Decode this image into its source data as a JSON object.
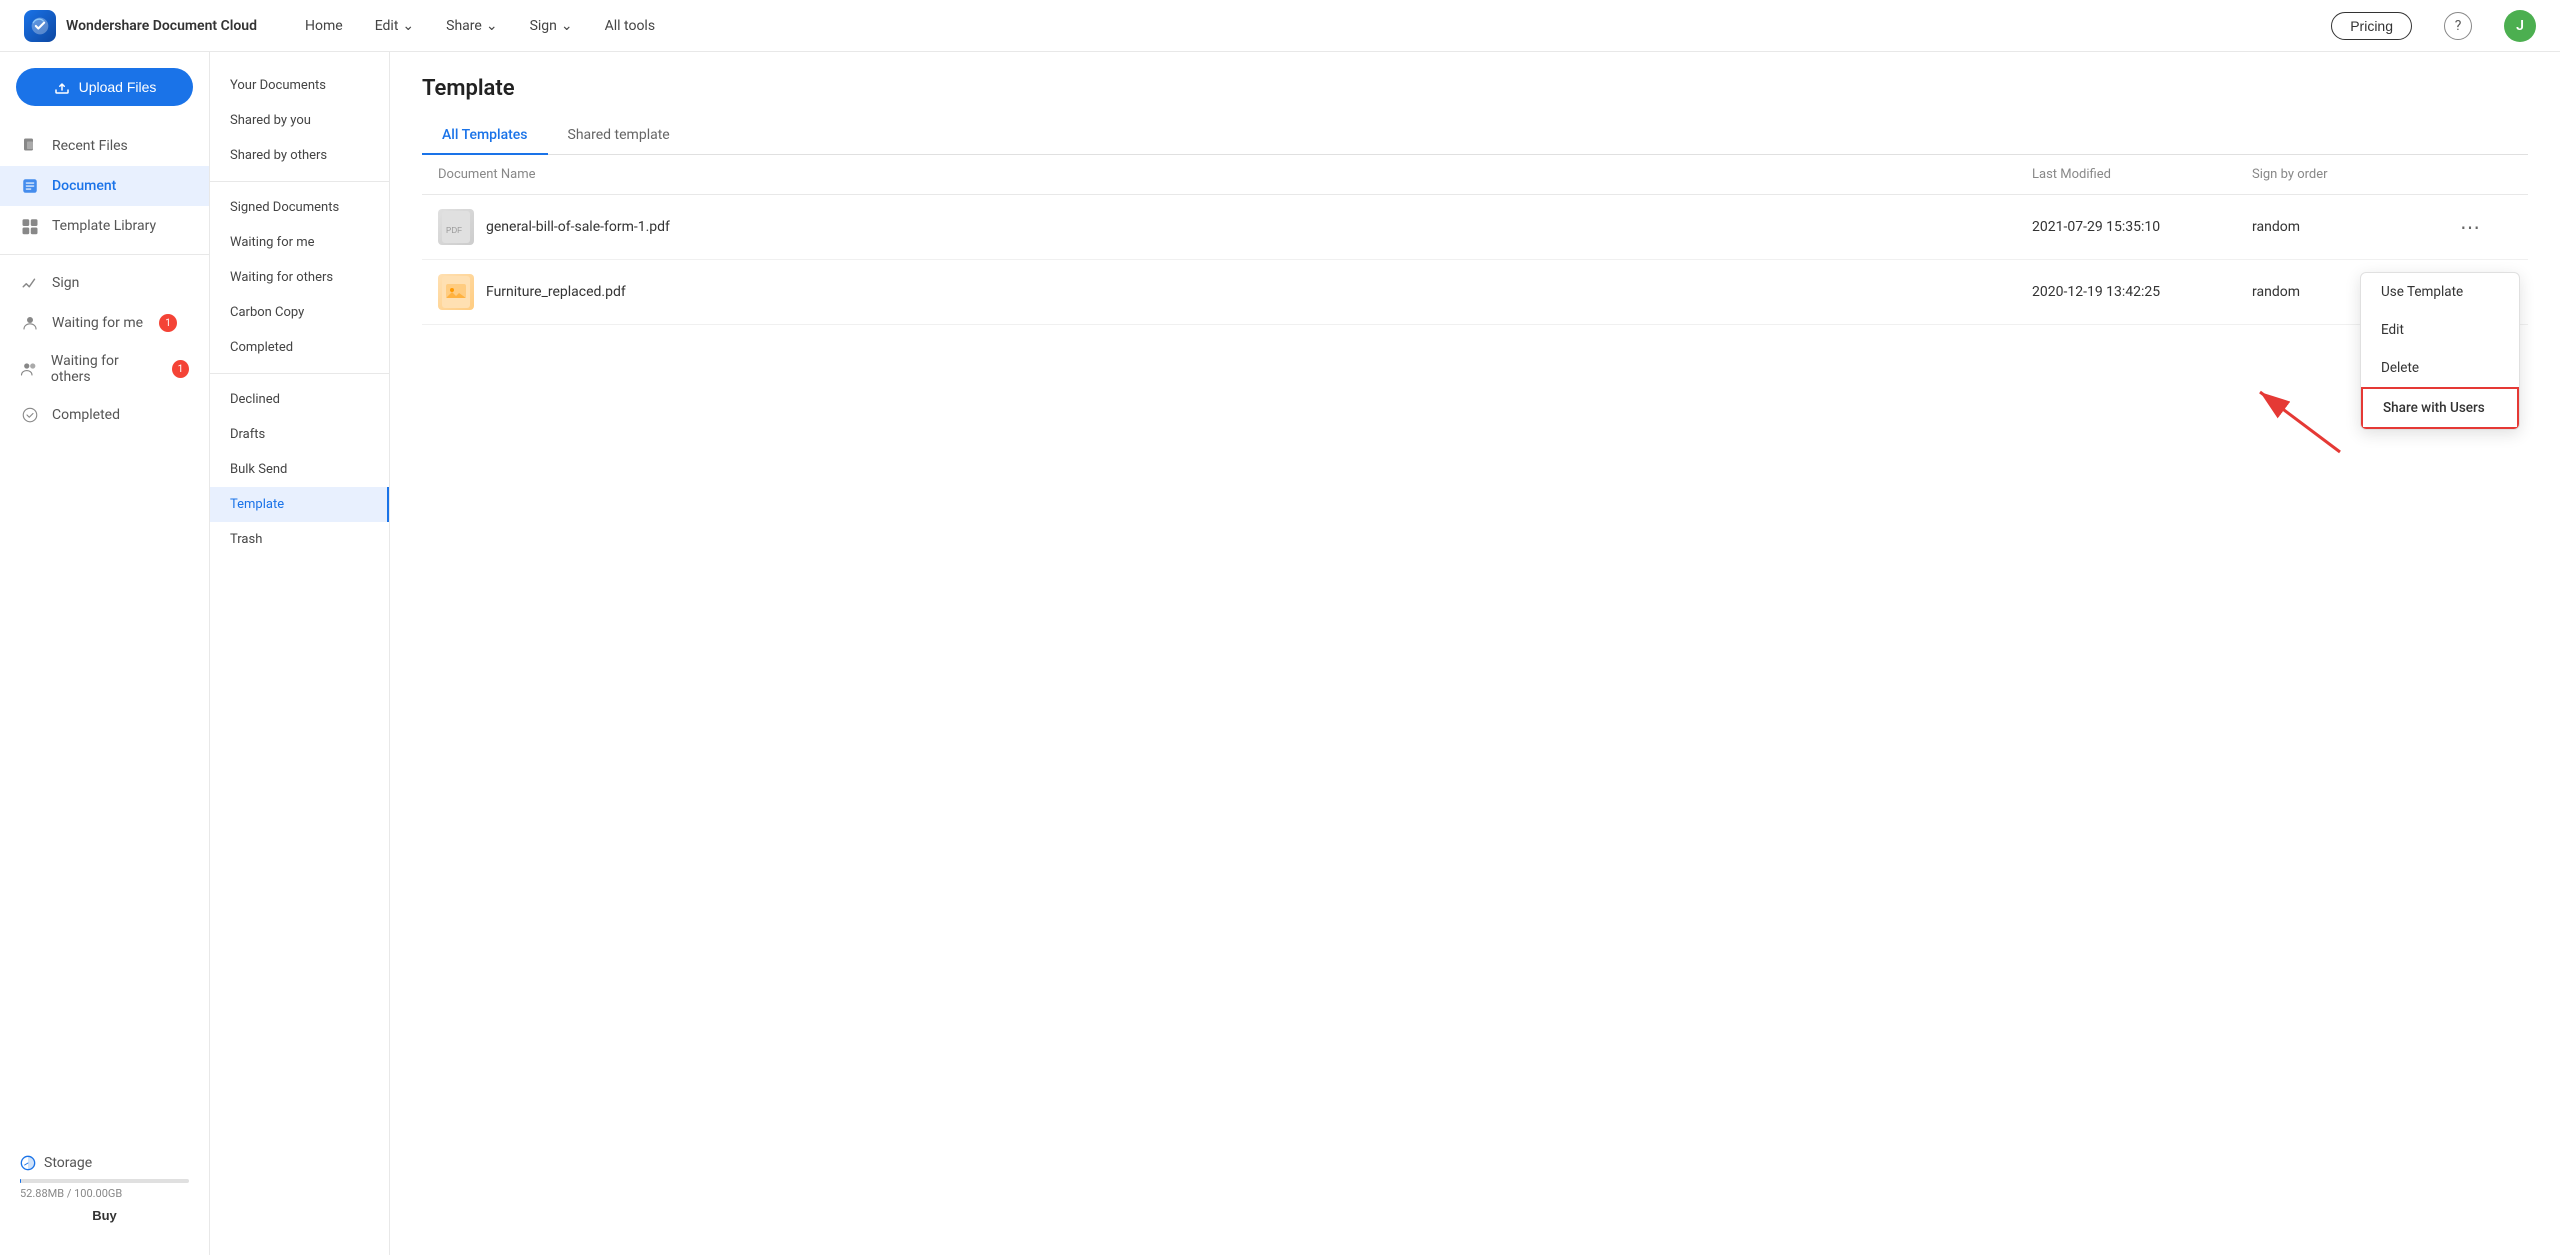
{
  "app": {
    "name": "Wondershare Document Cloud"
  },
  "topnav": {
    "home": "Home",
    "edit": "Edit",
    "share": "Share",
    "sign": "Sign",
    "all_tools": "All tools",
    "pricing": "Pricing",
    "avatar_initial": "J"
  },
  "upload": {
    "label": "Upload Files"
  },
  "left_sidebar": {
    "items": [
      {
        "id": "recent-files",
        "label": "Recent Files"
      },
      {
        "id": "document",
        "label": "Document"
      },
      {
        "id": "template-library",
        "label": "Template Library"
      },
      {
        "id": "sign",
        "label": "Sign"
      },
      {
        "id": "waiting-for-me",
        "label": "Waiting for me",
        "badge": "1"
      },
      {
        "id": "waiting-for-others",
        "label": "Waiting for others",
        "badge": "1"
      },
      {
        "id": "completed",
        "label": "Completed"
      }
    ]
  },
  "storage": {
    "label": "Storage",
    "used": "52.88MB / 100.00GB",
    "buy_label": "Buy"
  },
  "mid_sidebar": {
    "items": [
      {
        "id": "your-documents",
        "label": "Your Documents"
      },
      {
        "id": "shared-by-you",
        "label": "Shared by you"
      },
      {
        "id": "shared-by-others",
        "label": "Shared by others"
      }
    ],
    "divider1": true,
    "items2": [
      {
        "id": "signed-documents",
        "label": "Signed Documents"
      },
      {
        "id": "waiting-for-me",
        "label": "Waiting for me"
      },
      {
        "id": "waiting-for-others",
        "label": "Waiting for others"
      },
      {
        "id": "carbon-copy",
        "label": "Carbon Copy"
      },
      {
        "id": "completed",
        "label": "Completed"
      }
    ],
    "divider2": true,
    "items3": [
      {
        "id": "declined",
        "label": "Declined"
      },
      {
        "id": "drafts",
        "label": "Drafts"
      },
      {
        "id": "bulk-send",
        "label": "Bulk Send"
      },
      {
        "id": "template",
        "label": "Template"
      },
      {
        "id": "trash",
        "label": "Trash"
      }
    ]
  },
  "main": {
    "page_title": "Template",
    "tabs": [
      {
        "id": "all-templates",
        "label": "All Templates",
        "active": true
      },
      {
        "id": "shared-template",
        "label": "Shared template",
        "active": false
      }
    ],
    "table": {
      "columns": [
        "Document Name",
        "Last Modified",
        "Sign by order",
        ""
      ],
      "rows": [
        {
          "name": "general-bill-of-sale-form-1.pdf",
          "last_modified": "2021-07-29 15:35:10",
          "sign_by_order": "random",
          "type": "pdf"
        },
        {
          "name": "Furniture_replaced.pdf",
          "last_modified": "2020-12-19 13:42:25",
          "sign_by_order": "random",
          "type": "img"
        }
      ]
    }
  },
  "context_menu": {
    "items": [
      {
        "id": "use-template",
        "label": "Use Template"
      },
      {
        "id": "edit",
        "label": "Edit"
      },
      {
        "id": "delete",
        "label": "Delete"
      },
      {
        "id": "share-with-users",
        "label": "Share with Users",
        "highlight": true
      }
    ]
  }
}
